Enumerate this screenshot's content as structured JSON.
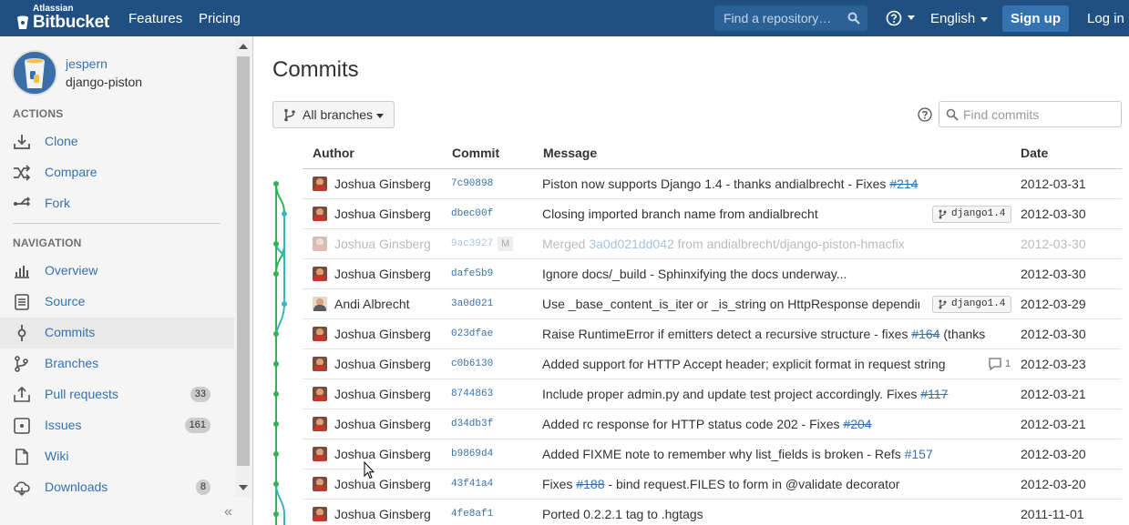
{
  "header": {
    "brand_small": "Atlassian",
    "brand": "Bitbucket",
    "nav": [
      "Features",
      "Pricing"
    ],
    "search_placeholder": "Find a repository…",
    "language": "English",
    "signup": "Sign up",
    "login": "Log in",
    "brand_color": "#205081"
  },
  "sidebar": {
    "owner": "jespern",
    "repo": "django-piston",
    "actions_title": "ACTIONS",
    "actions": [
      {
        "label": "Clone",
        "icon": "clone-icon"
      },
      {
        "label": "Compare",
        "icon": "compare-icon"
      },
      {
        "label": "Fork",
        "icon": "fork-icon"
      }
    ],
    "navigation_title": "NAVIGATION",
    "navigation": [
      {
        "label": "Overview",
        "icon": "overview-icon",
        "count": ""
      },
      {
        "label": "Source",
        "icon": "source-icon",
        "count": ""
      },
      {
        "label": "Commits",
        "icon": "commits-icon",
        "count": "",
        "active": true
      },
      {
        "label": "Branches",
        "icon": "branches-icon",
        "count": ""
      },
      {
        "label": "Pull requests",
        "icon": "pull-requests-icon",
        "count": "33"
      },
      {
        "label": "Issues",
        "icon": "issues-icon",
        "count": "161"
      },
      {
        "label": "Wiki",
        "icon": "wiki-icon",
        "count": ""
      },
      {
        "label": "Downloads",
        "icon": "downloads-icon",
        "count": "8"
      }
    ],
    "collapse": "«"
  },
  "main": {
    "title": "Commits",
    "branch_filter": "All branches",
    "find_placeholder": "Find commits",
    "columns": {
      "author": "Author",
      "commit": "Commit",
      "message": "Message",
      "date": "Date"
    },
    "commits": [
      {
        "author": "Joshua Ginsberg",
        "hash": "7c90898",
        "message": "Piston now supports Django 1.4 - thanks andialbrecht - Fixes ",
        "ref": "#214",
        "ref_struck": true,
        "ref_tail": "",
        "tag": "",
        "comments": "",
        "date": "2012-03-31",
        "merge": false
      },
      {
        "author": "Joshua Ginsberg",
        "hash": "dbec00f",
        "message": "Closing imported branch name from andialbrecht",
        "ref": "",
        "ref_struck": false,
        "ref_tail": "",
        "tag": "django1.4",
        "comments": "",
        "date": "2012-03-30",
        "merge": false
      },
      {
        "author": "Joshua Ginsberg",
        "hash": "9ac3927",
        "badge": "M",
        "message": "Merged ",
        "ref": "3a0d021dd042",
        "ref_struck": false,
        "ref_tail": " from andialbrecht/django-piston-hmacfix",
        "tag": "",
        "comments": "",
        "date": "2012-03-30",
        "merge": true
      },
      {
        "author": "Joshua Ginsberg",
        "hash": "dafe5b9",
        "message": "Ignore docs/_build - Sphinxifying the docs underway...",
        "ref": "",
        "ref_struck": false,
        "ref_tail": "",
        "tag": "",
        "comments": "",
        "date": "2012-03-30",
        "merge": false
      },
      {
        "author": "Andi Albrecht",
        "hash": "3a0d021",
        "message": "Use _base_content_is_iter or _is_string on HttpResponse depending on Django version",
        "ref": "",
        "ref_struck": false,
        "ref_tail": "",
        "tag": "django1.4",
        "comments": "",
        "date": "2012-03-29",
        "merge": false
      },
      {
        "author": "Joshua Ginsberg",
        "hash": "023dfae",
        "message": "Raise RuntimeError if emitters detect a recursive structure - fixes ",
        "ref": "#164",
        "ref_struck": true,
        "ref_tail": " (thanks",
        "tag": "",
        "comments": "",
        "date": "2012-03-30",
        "merge": false
      },
      {
        "author": "Joshua Ginsberg",
        "hash": "c0b6130",
        "message": "Added support for HTTP Accept header; explicit format in request string",
        "ref": "",
        "ref_struck": false,
        "ref_tail": "",
        "tag": "",
        "comments": "1",
        "date": "2012-03-23",
        "merge": false
      },
      {
        "author": "Joshua Ginsberg",
        "hash": "8744863",
        "message": "Include proper admin.py and update test project accordingly. Fixes ",
        "ref": "#117",
        "ref_struck": true,
        "ref_tail": "",
        "tag": "",
        "comments": "",
        "date": "2012-03-21",
        "merge": false
      },
      {
        "author": "Joshua Ginsberg",
        "hash": "d34db3f",
        "message": "Added rc response for HTTP status code 202 - Fixes ",
        "ref": "#204",
        "ref_struck": true,
        "ref_tail": "",
        "tag": "",
        "comments": "",
        "date": "2012-03-21",
        "merge": false
      },
      {
        "author": "Joshua Ginsberg",
        "hash": "b9869d4",
        "message": "Added FIXME note to remember why list_fields is broken - Refs ",
        "ref": "#157",
        "ref_struck": false,
        "ref_tail": "",
        "tag": "",
        "comments": "",
        "date": "2012-03-20",
        "merge": false
      },
      {
        "author": "Joshua Ginsberg",
        "hash": "43f41a4",
        "message": "Fixes ",
        "ref": "#188",
        "ref_struck": true,
        "ref_tail": " - bind request.FILES to form in @validate decorator",
        "tag": "",
        "comments": "",
        "date": "2012-03-20",
        "merge": false
      },
      {
        "author": "Joshua Ginsberg",
        "hash": "4fe8af1",
        "message": "Ported 0.2.2.1 tag to .hgtags",
        "ref": "",
        "ref_struck": false,
        "ref_tail": "",
        "tag": "",
        "comments": "",
        "date": "2011-11-01",
        "merge": false
      }
    ],
    "graph_colors": {
      "main": "#2fb44f",
      "branch": "#3cb4c4"
    }
  }
}
